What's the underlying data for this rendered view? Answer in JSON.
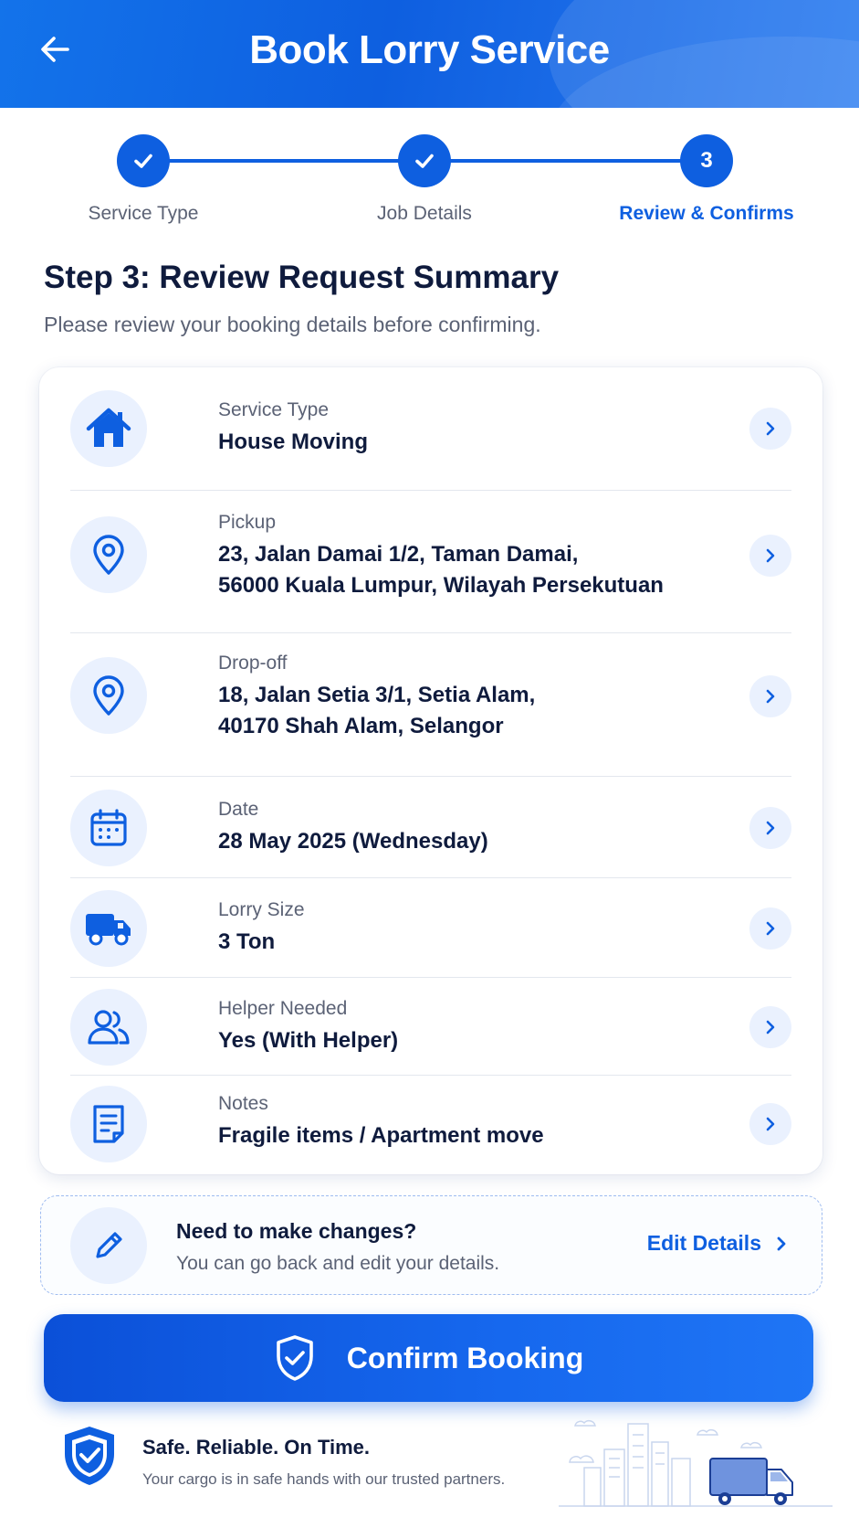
{
  "header": {
    "title": "Book Lorry Service",
    "back_icon": "arrow-left-icon"
  },
  "stepper": {
    "steps": [
      {
        "label": "Service Type",
        "state": "done"
      },
      {
        "label": "Job Details",
        "state": "done"
      },
      {
        "label": "Review & Confirms",
        "number": "3",
        "state": "active"
      }
    ]
  },
  "page": {
    "title": "Step 3: Review Request Summary",
    "subtitle": "Please review your booking details before confirming."
  },
  "summary": {
    "rows": [
      {
        "label": "Service Type",
        "value": "House Moving",
        "icon": "house-icon"
      },
      {
        "label": "Pickup",
        "value_line1": "23, Jalan Damai 1/2, Taman Damai,",
        "value_line2": "56000 Kuala Lumpur, Wilayah Persekutuan",
        "icon": "location-pin-icon"
      },
      {
        "label": "Drop-off",
        "value_line1": "18, Jalan Setia 3/1, Setia Alam,",
        "value_line2": "40170 Shah Alam, Selangor",
        "icon": "location-pin-icon"
      },
      {
        "label": "Date",
        "value": "28 May 2025 (Wednesday)",
        "icon": "calendar-icon"
      },
      {
        "label": "Lorry Size",
        "value": "3 Ton",
        "icon": "truck-icon"
      },
      {
        "label": "Helper Needed",
        "value": "Yes (With Helper)",
        "icon": "users-icon"
      },
      {
        "label": "Notes",
        "value": "Fragile items / Apartment move",
        "icon": "document-icon"
      }
    ]
  },
  "changes": {
    "title": "Need to make changes?",
    "subtitle": "You can go back and edit your details.",
    "link_label": "Edit Details"
  },
  "confirm": {
    "label": "Confirm Booking"
  },
  "footer": {
    "title": "Safe. Reliable. On Time.",
    "subtitle": "Your cargo is in safe hands with our trusted partners."
  },
  "colors": {
    "primary": "#0e5fe0",
    "text": "#0f1b3d",
    "muted": "#5b6275",
    "icon_bg": "#eaf1fe"
  }
}
